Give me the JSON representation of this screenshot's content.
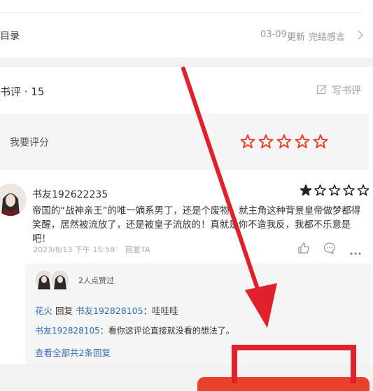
{
  "toc": {
    "label": "目录",
    "date": "03-09",
    "update_label": "更新",
    "latest_chapter": "完结感言"
  },
  "reviews": {
    "title": "书评 · 15",
    "write_label": "写书评",
    "rate_prompt": "我要评分",
    "rating_stars_total": 5,
    "rating_value": 0
  },
  "comment": {
    "username": "书友192622235",
    "stars_filled": 1,
    "stars_total": 5,
    "text": "帝国的“战神亲王”的唯一嫡系男丁，还是个废物！就主角这种背景皇帝做梦都得笑醒，居然被流放了，还是被皇子流放的！真就是你不造我反，我都不乐意是吧！",
    "timestamp": "2023/8/13 下午 15:58",
    "separator": "·",
    "reply_ta": "回复TA",
    "likes_label": "2人点赞过",
    "replies": [
      {
        "from": "花火",
        "verb": "回复",
        "to": "书友192828105",
        "text": "：哇哇哇"
      },
      {
        "from": "书友192828105",
        "text": "：看你这评论直接就没看的想法了。"
      }
    ],
    "view_all": "查看全部共2条回复"
  },
  "colors": {
    "accent": "#e8412c",
    "annotation": "#e0202a",
    "link": "#2f6bb3"
  },
  "icons": {
    "chevron": "chevron-right-icon",
    "edit": "edit-icon",
    "like": "thumbs-up-icon",
    "comment": "comment-icon",
    "more": "more-icon"
  }
}
